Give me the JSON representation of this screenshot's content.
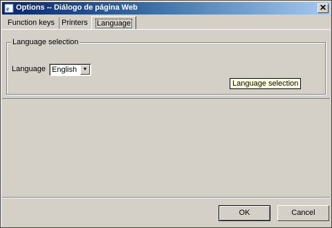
{
  "window": {
    "title": "Options -- Diálogo de página Web",
    "close_symbol": "✕"
  },
  "tabs": [
    {
      "label": "Function keys"
    },
    {
      "label": "Printers"
    },
    {
      "label": "Language"
    }
  ],
  "group": {
    "legend": "Language selection",
    "field_label": "Language",
    "select_value": "English",
    "select_arrow": "▼"
  },
  "tooltip": "Language selection",
  "buttons": {
    "ok": "OK",
    "cancel": "Cancel"
  },
  "icons": {
    "app": "ie-icon"
  }
}
